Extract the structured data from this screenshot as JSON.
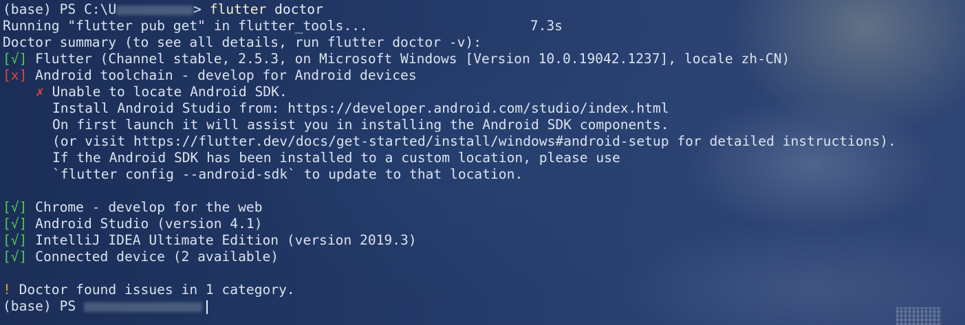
{
  "terminal": {
    "prompt1": {
      "prefix": "(base) PS C:\\U",
      "suffix": "> ",
      "command": "flutter",
      "args": " doctor"
    },
    "line_pub_get": "Running \"flutter pub get\" in flutter_tools...                    7.3s",
    "line_summary": "Doctor summary (to see all details, run flutter doctor -v):",
    "checks": [
      {
        "mark": "[√]",
        "status": "ok",
        "text": " Flutter (Channel stable, 2.5.3, on Microsoft Windows [Version 10.0.19042.1237], locale zh-CN)"
      },
      {
        "mark": "[x]",
        "status": "error",
        "text": " Android toolchain - develop for Android devices"
      }
    ],
    "android_error": {
      "mark": "✗",
      "text": " Unable to locate Android SDK.",
      "details": [
        "Install Android Studio from: https://developer.android.com/studio/index.html",
        "On first launch it will assist you in installing the Android SDK components.",
        "(or visit https://flutter.dev/docs/get-started/install/windows#android-setup for detailed instructions).",
        "If the Android SDK has been installed to a custom location, please use",
        "`flutter config --android-sdk` to update to that location."
      ]
    },
    "checks2": [
      {
        "mark": "[√]",
        "status": "ok",
        "text": " Chrome - develop for the web"
      },
      {
        "mark": "[√]",
        "status": "ok",
        "text": " Android Studio (version 4.1)"
      },
      {
        "mark": "[√]",
        "status": "ok",
        "text": " IntelliJ IDEA Ultimate Edition (version 2019.3)"
      },
      {
        "mark": "[√]",
        "status": "ok",
        "text": " Connected device (2 available)"
      }
    ],
    "issues": {
      "mark": "!",
      "text": " Doctor found issues in 1 category."
    },
    "prompt2": {
      "prefix": "(base) PS "
    }
  },
  "colors": {
    "ok": "#4fcc52",
    "error": "#e2453f",
    "warning": "#e9a740",
    "command": "#f5f0c8"
  }
}
